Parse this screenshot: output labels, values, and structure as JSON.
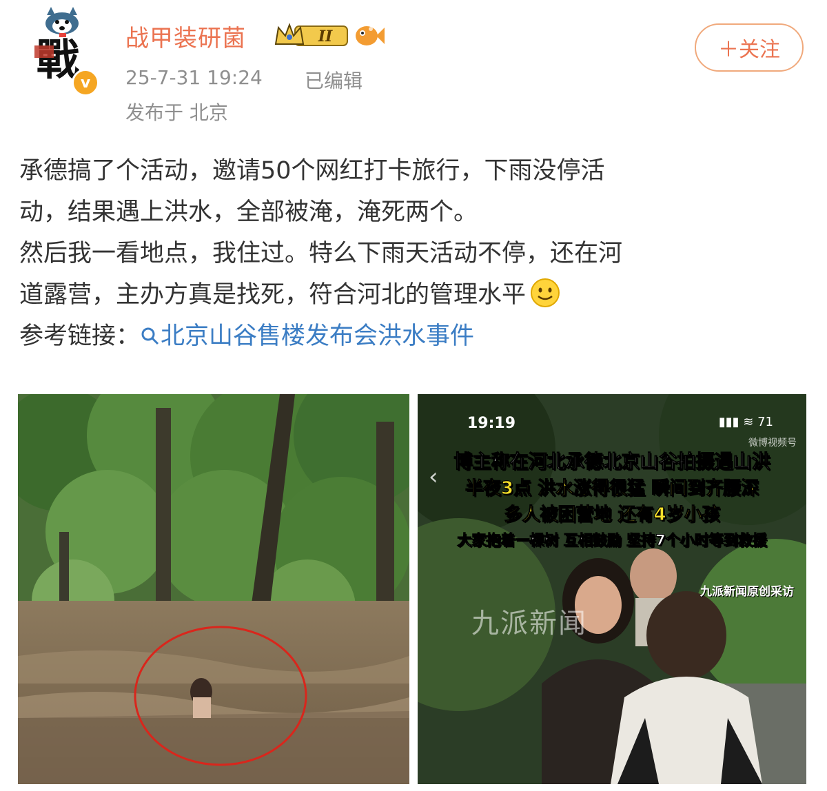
{
  "user": {
    "name": "战甲装研菌",
    "avatar_char": "戰",
    "verified_mark": "v",
    "level_badge": "II"
  },
  "meta": {
    "time": "25-7-31 19:24",
    "edited": "已编辑",
    "location": "发布于 北京"
  },
  "follow": {
    "label": "＋关注"
  },
  "post": {
    "line1": "承德搞了个活动，邀请50个网红打卡旅行，下雨没停活",
    "line2": "动，结果遇上洪水，全部被淹，淹死两个。",
    "line3": "然后我一看地点，我住过。特么下雨天活动不停，还在河",
    "line4": "道露营，主办方真是找死，符合河北的管理水平",
    "ref_label": "参考链接：",
    "ref_link": "北京山谷售楼发布会洪水事件"
  },
  "image2": {
    "time": "19:19",
    "battery": "71",
    "watermark_top": "微博视频号",
    "caption1": "博主称在河北承德北京山谷拍摄遇山洪",
    "caption2": "半夜3点 洪水涨得很猛 瞬间到齐腰深",
    "caption3": "多人被困营地 还有4岁小孩",
    "caption4": "大家抱着一棵树 互相鼓励 坚持7个小时等到救援",
    "watermark_right": "九派新闻原创采访",
    "watermark_center": "九派新闻"
  },
  "colors": {
    "username": "#eb7350",
    "link": "#3b7dc4",
    "meta": "#8f8f8f",
    "caption_yellow": "#f5e12a"
  },
  "icons": {
    "verified": "verified-badge-icon",
    "crown": "crown-level-icon",
    "fish": "fish-icon",
    "smiley": "smiley-emoji-icon",
    "search": "search-icon"
  }
}
